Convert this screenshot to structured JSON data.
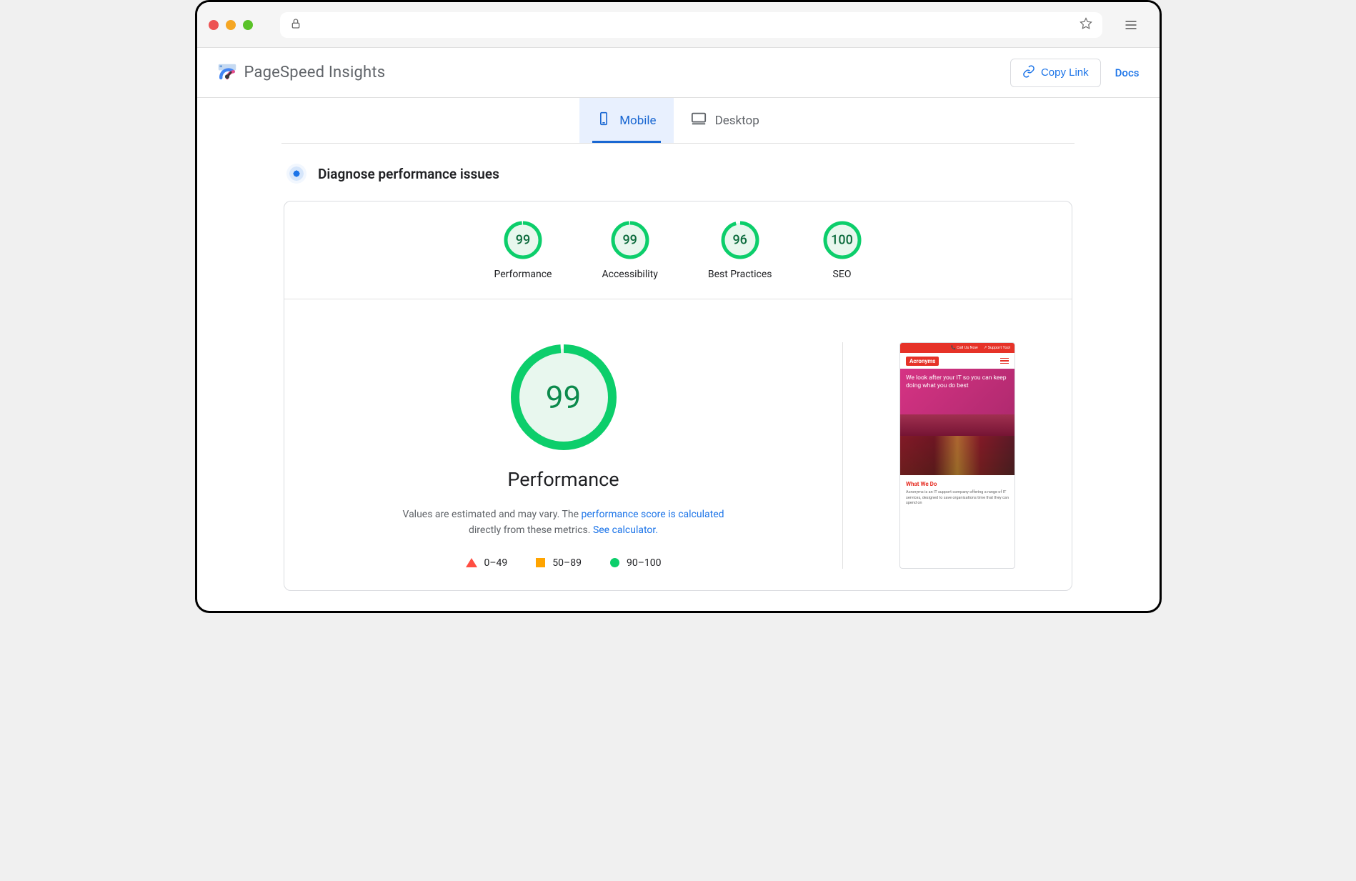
{
  "app": {
    "title": "PageSpeed Insights"
  },
  "header": {
    "copyLink": "Copy Link",
    "docs": "Docs"
  },
  "tabs": {
    "mobile": "Mobile",
    "desktop": "Desktop"
  },
  "diagnose": {
    "title": "Diagnose performance issues"
  },
  "scores": [
    {
      "label": "Performance",
      "value": "99",
      "pct": 99
    },
    {
      "label": "Accessibility",
      "value": "99",
      "pct": 99
    },
    {
      "label": "Best Practices",
      "value": "96",
      "pct": 96
    },
    {
      "label": "SEO",
      "value": "100",
      "pct": 100
    }
  ],
  "performanceDetail": {
    "score": "99",
    "heading": "Performance",
    "descPrefix": "Values are estimated and may vary. The ",
    "descLink1": "performance score is calculated",
    "descMid": " directly from these metrics. ",
    "descLink2": "See calculator.",
    "legend": {
      "fail": "0–49",
      "avg": "50–89",
      "pass": "90–100"
    }
  },
  "preview": {
    "topbar": {
      "call": "📞 Call Us Now",
      "support": "↗ Support Tool"
    },
    "logo": "Acronyms",
    "heroText": "We look after your IT so you can keep doing what you do best",
    "whatWeDo": {
      "title": "What We Do",
      "text": "Acronyms is an IT support company offering a range of IT services, designed to save organisations time that they can spend on"
    }
  }
}
